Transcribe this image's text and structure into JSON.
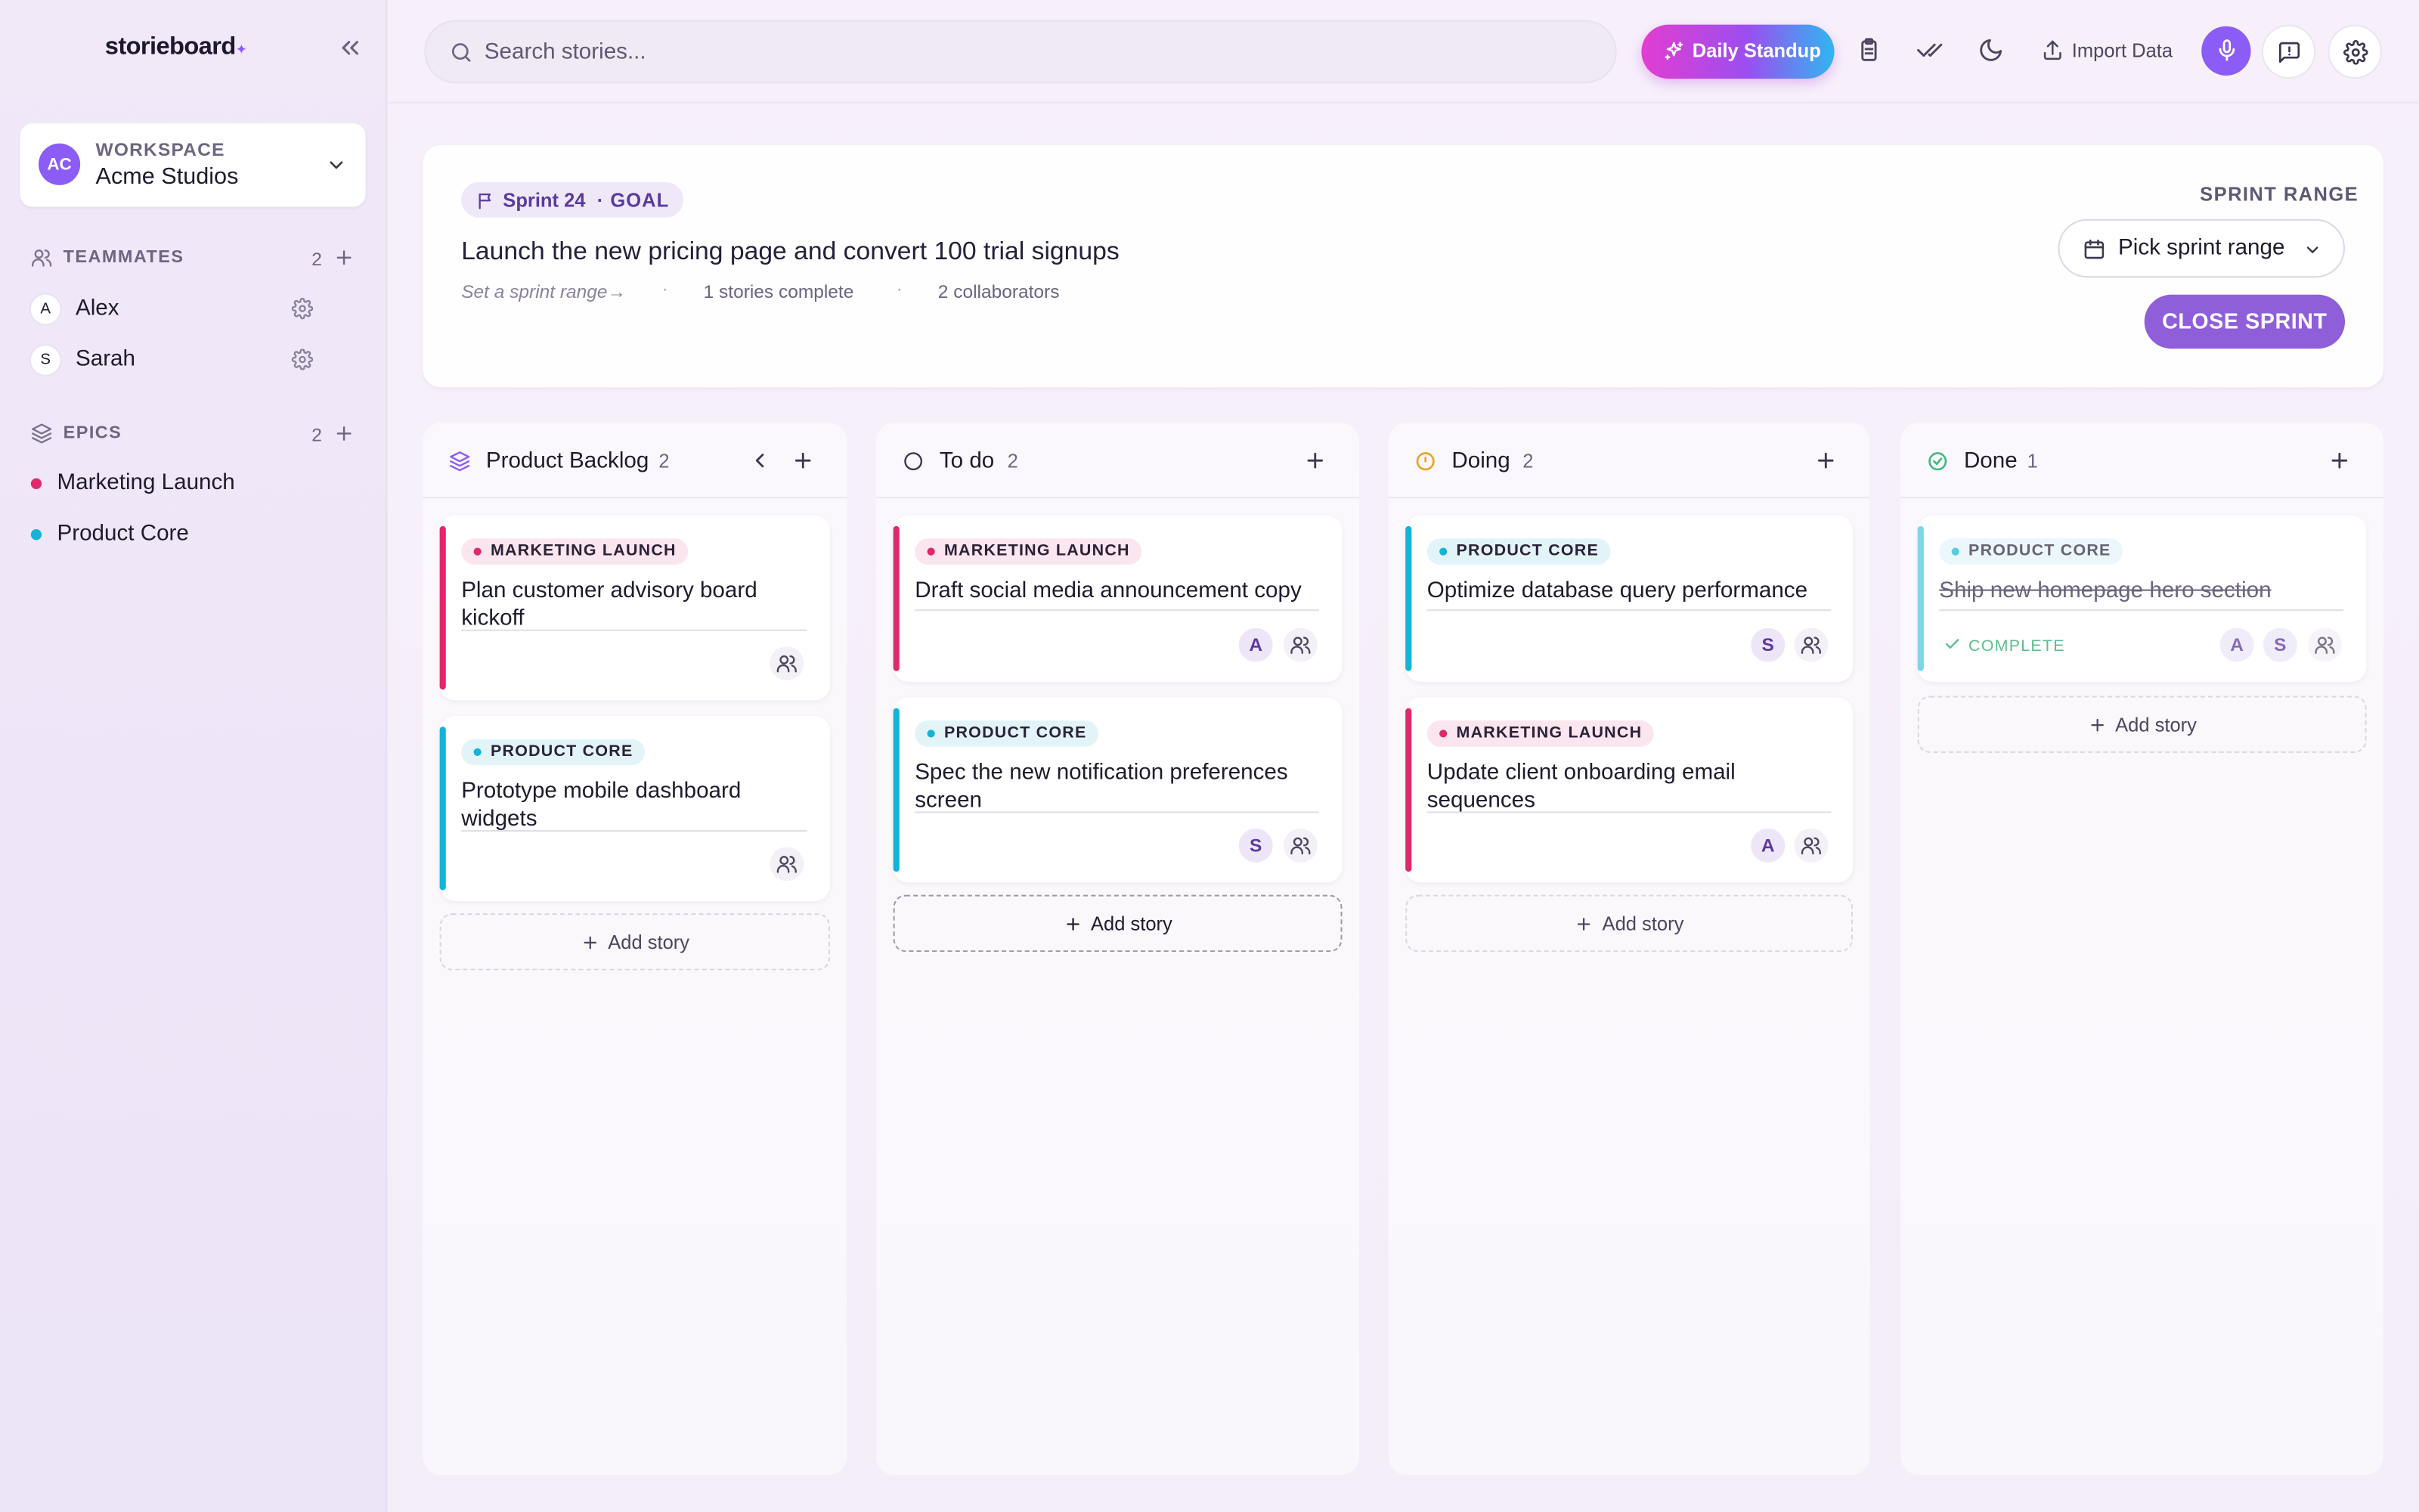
{
  "sidebar": {
    "logo": "storieboard",
    "workspace": {
      "initials": "AC",
      "label": "WORKSPACE",
      "name": "Acme Studios"
    },
    "teammates": {
      "label": "TEAMMATES",
      "count": "2",
      "items": [
        {
          "initial": "A",
          "name": "Alex"
        },
        {
          "initial": "S",
          "name": "Sarah"
        }
      ]
    },
    "epics": {
      "label": "EPICS",
      "count": "2",
      "items": [
        {
          "name": "Marketing Launch",
          "color": "#e0296b"
        },
        {
          "name": "Product Core",
          "color": "#13b4d6"
        }
      ]
    }
  },
  "topbar": {
    "search_placeholder": "Search stories...",
    "standup_label": "Daily Standup",
    "import_label": "Import Data"
  },
  "sprint": {
    "name": "Sprint 24",
    "goal_tag": "· GOAL",
    "goal": "Launch the new pricing page and convert 100 trial signups",
    "range_hint": "Set a sprint range→",
    "separator": "·",
    "stories_complete": "1 stories complete",
    "collaborators": "2 collaborators",
    "range_label": "SPRINT RANGE",
    "pick_label": "Pick sprint range",
    "close_label": "CLOSE SPRINT"
  },
  "columns": [
    {
      "title": "Product Backlog",
      "count": "2",
      "cards": [
        {
          "epic": "MARKETING LAUNCH",
          "title": "Plan customer advisory board kickoff",
          "assignees": []
        },
        {
          "epic": "PRODUCT CORE",
          "title": "Prototype mobile dashboard widgets",
          "assignees": []
        }
      ],
      "add_label": "Add story"
    },
    {
      "title": "To do",
      "count": "2",
      "cards": [
        {
          "epic": "MARKETING LAUNCH",
          "title": "Draft social media announcement copy",
          "assignees": [
            "A"
          ]
        },
        {
          "epic": "PRODUCT CORE",
          "title": "Spec the new notification preferences screen",
          "assignees": [
            "S"
          ]
        }
      ],
      "add_label": "Add story"
    },
    {
      "title": "Doing",
      "count": "2",
      "cards": [
        {
          "epic": "PRODUCT CORE",
          "title": "Optimize database query performance",
          "assignees": [
            "S"
          ]
        },
        {
          "epic": "MARKETING LAUNCH",
          "title": "Update client onboarding email sequences",
          "assignees": [
            "A"
          ]
        }
      ],
      "add_label": "Add story"
    },
    {
      "title": "Done",
      "count": "1",
      "cards": [
        {
          "epic": "PRODUCT CORE",
          "title": "Ship new homepage hero section",
          "status": "COMPLETE",
          "assignees": [
            "A",
            "S"
          ]
        }
      ],
      "add_label": "Add story"
    }
  ],
  "colors": {
    "accent": "#8b5cf6",
    "marketing": "#e0296b",
    "product": "#13b4d6",
    "doing": "#f0a020",
    "done": "#3fb87f"
  }
}
